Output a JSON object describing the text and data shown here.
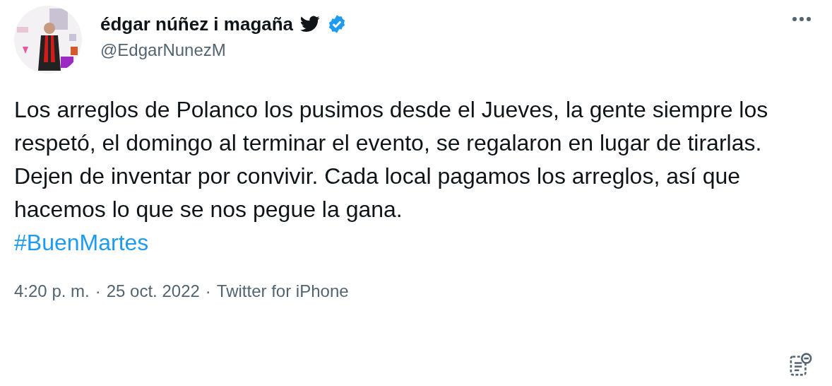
{
  "author": {
    "name": "édgar núñez i magaña",
    "handle": "@EdgarNunezM",
    "verified": true
  },
  "tweet": {
    "text": "Los arreglos de Polanco los pusimos desde el Jueves, la gente siempre los respetó, el domingo al terminar el evento, se regalaron en lugar de tirarlas. Dejen de inventar por convivir. Cada local pagamos los arreglos, así que hacemos lo que se nos pegue la gana.",
    "hashtag": "#BuenMartes"
  },
  "footer": {
    "time": "4:20 p. m.",
    "separator_1": "·",
    "date": "25 oct. 2022",
    "separator_2": "·",
    "source": "Twitter for iPhone"
  }
}
